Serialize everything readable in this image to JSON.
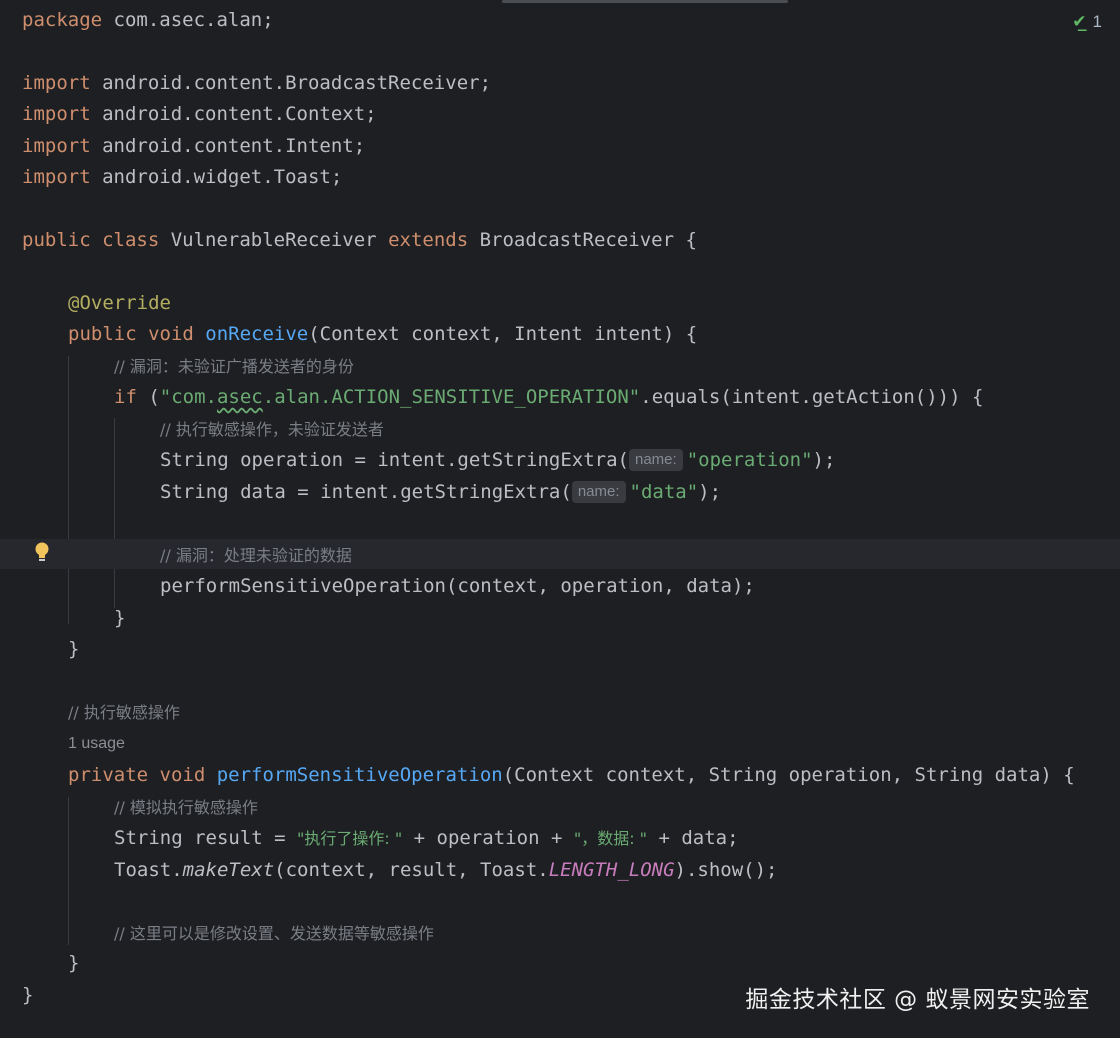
{
  "status": {
    "check_count": "1"
  },
  "code": {
    "pkg_kw": "package",
    "pkg_name": " com.asec.alan;",
    "import_kw": "import",
    "imports": [
      " android.content.BroadcastReceiver;",
      " android.content.Context;",
      " android.content.Intent;",
      " android.widget.Toast;"
    ],
    "class_public": "public",
    "class_kw": " class",
    "class_name": " VulnerableReceiver ",
    "extends_kw": "extends",
    "class_super": " BroadcastReceiver {",
    "override": "@Override",
    "onreceive_mod": "public",
    "onreceive_void": " void ",
    "onreceive_name": "onReceive",
    "onreceive_params": "(Context context, Intent intent) {",
    "comment1": "// 漏洞：未验证广播发送者的身份",
    "if_kw": "if",
    "if_open": " (",
    "action_str_a": "\"com.",
    "action_str_b": "asec",
    "action_str_c": ".alan.ACTION_SENSITIVE_OPERATION\"",
    "if_rest": ".equals(intent.getAction())) {",
    "comment2": "// 执行敏感操作，未验证发送者",
    "op_decl": "String operation = intent.getStringExtra(",
    "hint_name": "name:",
    "op_str": "\"operation\"",
    "op_end": ");",
    "data_decl": "String data = intent.getStringExtra(",
    "data_str": "\"data\"",
    "data_end": ");",
    "comment3": "// 漏洞：处理未验证的数据",
    "perform_call": "performSensitiveOperation(context, operation, data);",
    "close_brace": "}",
    "comment4": "// 执行敏感操作",
    "usage": "1 usage",
    "private_kw": "private",
    "void_kw": " void ",
    "perform_name": "performSensitiveOperation",
    "perform_params": "(Context context, String operation, String data) {",
    "comment5": "// 模拟执行敏感操作",
    "result_decl": "String result = ",
    "result_str1": "\"执行了操作: \"",
    "result_mid": " + operation + ",
    "result_str2": "\"，数据: \"",
    "result_end": " + data;",
    "toast_a": "Toast.",
    "toast_make": "makeText",
    "toast_b": "(context, result, Toast.",
    "toast_const": "LENGTH_LONG",
    "toast_c": ").show();",
    "comment6": "// 这里可以是修改设置、发送数据等敏感操作"
  },
  "watermark": "掘金技术社区 @ 蚁景网安实验室",
  "colors": {
    "background": "#1e1f22",
    "keyword": "#cf8e6d",
    "string": "#6aab73",
    "function": "#56a8f5",
    "comment": "#7a7e85",
    "annotation": "#b3ae60",
    "constant": "#c77dbb"
  }
}
